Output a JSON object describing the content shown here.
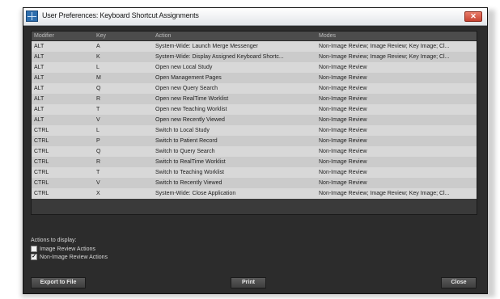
{
  "window": {
    "title": "User Preferences: Keyboard Shortcut Assignments",
    "close_glyph": "✕"
  },
  "table": {
    "columns": [
      "Modifier",
      "Key",
      "Action",
      "Modes"
    ],
    "rows": [
      [
        "ALT",
        "A",
        "System-Wide: Launch Merge Messenger",
        "Non-Image Review; Image Review; Key Image; Cl..."
      ],
      [
        "ALT",
        "K",
        "System-Wide: Display Assigned Keyboard Shortc...",
        "Non-Image Review; Image Review; Key Image; Cl..."
      ],
      [
        "ALT",
        "L",
        "Open new Local Study",
        "Non-Image Review"
      ],
      [
        "ALT",
        "M",
        "Open Management Pages",
        "Non-Image Review"
      ],
      [
        "ALT",
        "Q",
        "Open new Query Search",
        "Non-Image Review"
      ],
      [
        "ALT",
        "R",
        "Open new RealTime Worklist",
        "Non-Image Review"
      ],
      [
        "ALT",
        "T",
        "Open new Teaching Worklist",
        "Non-Image Review"
      ],
      [
        "ALT",
        "V",
        "Open new Recently Viewed",
        "Non-Image Review"
      ],
      [
        "CTRL",
        "L",
        "Switch to Local Study",
        "Non-Image Review"
      ],
      [
        "CTRL",
        "P",
        "Switch to Patient Record",
        "Non-Image Review"
      ],
      [
        "CTRL",
        "Q",
        "Switch to Query Search",
        "Non-Image Review"
      ],
      [
        "CTRL",
        "R",
        "Switch to RealTime Worklist",
        "Non-Image Review"
      ],
      [
        "CTRL",
        "T",
        "Switch to Teaching Worklist",
        "Non-Image Review"
      ],
      [
        "CTRL",
        "V",
        "Switch to Recently Viewed",
        "Non-Image Review"
      ],
      [
        "CTRL",
        "X",
        "System-Wide: Close Application",
        "Non-Image Review; Image Review; Key Image; Cl..."
      ]
    ]
  },
  "filters": {
    "label": "Actions to display:",
    "options": [
      {
        "label": "Image Review Actions",
        "checked": false
      },
      {
        "label": "Non-Image Review Actions",
        "checked": true
      }
    ]
  },
  "buttons": {
    "export": "Export to File",
    "print": "Print",
    "close": "Close"
  }
}
